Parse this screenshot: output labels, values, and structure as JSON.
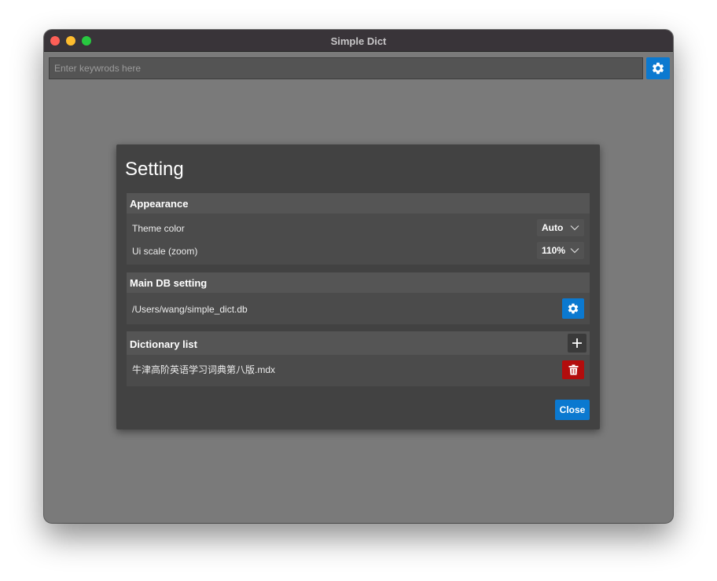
{
  "window": {
    "title": "Simple Dict"
  },
  "search": {
    "placeholder": "Enter keywrods here",
    "value": ""
  },
  "dialog": {
    "title": "Setting",
    "appearance": {
      "header": "Appearance",
      "theme_label": "Theme color",
      "theme_value": "Auto",
      "scale_label": "Ui scale (zoom)",
      "scale_value": "110%"
    },
    "db": {
      "header": "Main DB setting",
      "path": "/Users/wang/simple_dict.db"
    },
    "dictionaries": {
      "header": "Dictionary list",
      "items": [
        "牛津高阶英语学习词典第八版.mdx"
      ]
    },
    "close_label": "Close"
  },
  "icons": {
    "settings": "gear-icon",
    "db_settings": "gear-icon",
    "add": "plus-icon",
    "delete": "trash-icon",
    "dropdown": "chevron-down-icon"
  },
  "colors": {
    "accent": "#0b79d0",
    "danger": "#b30d0d",
    "dialog_bg": "#424242",
    "window_bg": "#7a7a7a"
  }
}
